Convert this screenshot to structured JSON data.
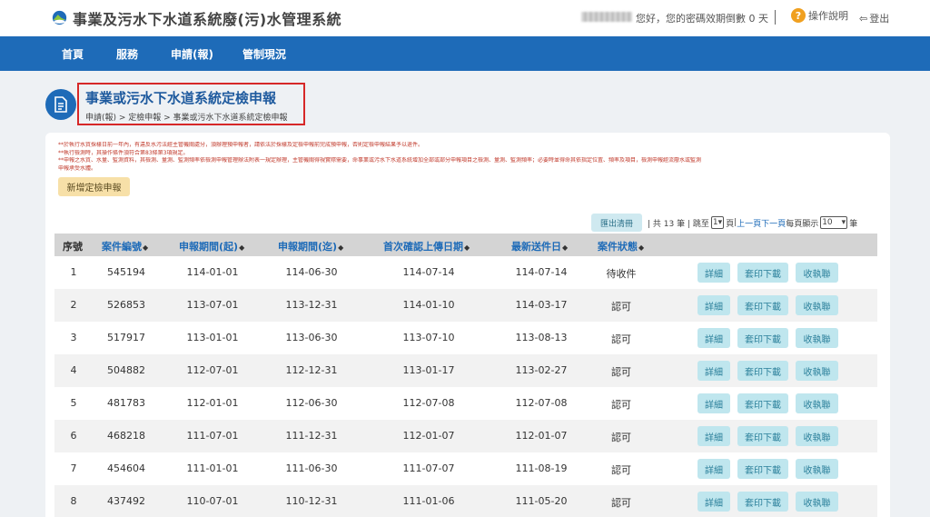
{
  "header": {
    "site_title": "事業及污水下水道系統廢(污)水管理系統",
    "greeting": "您好，您的密碼效期倒數 0 天",
    "help_label": "操作說明",
    "logout_label": "登出"
  },
  "nav": [
    {
      "label": "首頁"
    },
    {
      "label": "服務"
    },
    {
      "label": "申請(報)"
    },
    {
      "label": "管制現況"
    }
  ],
  "page": {
    "title": "事業或污水下水道系統定檢申報",
    "breadcrumb": "申請(報) > 定檢申報 > 事業或污水下水道系統定檢申報"
  },
  "notes": [
    "**於執行水質採樣日前一年內，有違反水污法經主管機關處分，須辦理預申報者，請依法於採樣及定檢申報前完成預申報，否則定檢申報結果予以退件。",
    "**執行檢測時，其操作條件須符合第83條第3項規定。",
    "**申報之水質、水量、監測資料，其檢測、量測、監測頻率依檢測申報管理辦法附表一規定辦理，主管機關得視實際需要，命事業或污水下水道系統增加全部或部分申報項目之檢測、量測、監測頻率；必要時並得命其依指定位置、頻率及項目，檢測申報經流廢水或監測",
    "申報承受水體。"
  ],
  "actions": {
    "add_label": "新增定檢申報",
    "export_label": "匯出清冊"
  },
  "pager": {
    "total_text": "| 共 13 筆 | 跳至",
    "page_value": "1",
    "page_unit": "頁",
    "prev_label": "上一頁",
    "next_label": "下一頁",
    "per_page_text": "每頁顯示",
    "per_page_value": "10",
    "per_page_unit": "筆"
  },
  "table": {
    "columns": [
      "序號",
      "案件編號",
      "申報期間(起)",
      "申報期間(迄)",
      "首次確認上傳日期",
      "最新送件日",
      "案件狀態"
    ],
    "button_labels": {
      "detail": "詳細",
      "print": "套印下載",
      "receipt": "收執聯"
    },
    "rows": [
      {
        "no": "1",
        "case_id": "545194",
        "start": "114-01-01",
        "end": "114-06-30",
        "first_upload": "114-07-14",
        "latest_submit": "114-07-14",
        "status": "待收件"
      },
      {
        "no": "2",
        "case_id": "526853",
        "start": "113-07-01",
        "end": "113-12-31",
        "first_upload": "114-01-10",
        "latest_submit": "114-03-17",
        "status": "認可"
      },
      {
        "no": "3",
        "case_id": "517917",
        "start": "113-01-01",
        "end": "113-06-30",
        "first_upload": "113-07-10",
        "latest_submit": "113-08-13",
        "status": "認可"
      },
      {
        "no": "4",
        "case_id": "504882",
        "start": "112-07-01",
        "end": "112-12-31",
        "first_upload": "113-01-17",
        "latest_submit": "113-02-27",
        "status": "認可"
      },
      {
        "no": "5",
        "case_id": "481783",
        "start": "112-01-01",
        "end": "112-06-30",
        "first_upload": "112-07-08",
        "latest_submit": "112-07-08",
        "status": "認可"
      },
      {
        "no": "6",
        "case_id": "468218",
        "start": "111-07-01",
        "end": "111-12-31",
        "first_upload": "112-01-07",
        "latest_submit": "112-01-07",
        "status": "認可"
      },
      {
        "no": "7",
        "case_id": "454604",
        "start": "111-01-01",
        "end": "111-06-30",
        "first_upload": "111-07-07",
        "latest_submit": "111-08-19",
        "status": "認可"
      },
      {
        "no": "8",
        "case_id": "437492",
        "start": "110-07-01",
        "end": "110-12-31",
        "first_upload": "111-01-06",
        "latest_submit": "111-05-20",
        "status": "認可"
      }
    ]
  },
  "colors": {
    "brand_blue": "#1e6bb8",
    "title_blue": "#1e5a9e",
    "highlight_red": "#d62828",
    "note_red": "#c0392b",
    "action_button_bg": "#bfe6ee",
    "add_button_bg": "#f7e0a8"
  },
  "icons": {
    "logo": "water-drop-logo-icon",
    "help": "question-circle-icon",
    "logout": "sign-out-icon",
    "page": "document-icon",
    "sort": "sort-icon"
  }
}
